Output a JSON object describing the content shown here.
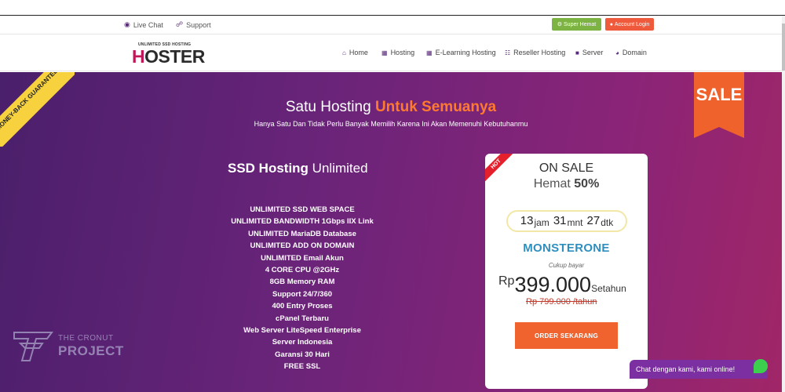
{
  "topbar": {
    "live_chat": "Live Chat",
    "support": "Support",
    "super_hemat": "Super Hemat",
    "account_login": "Account Login"
  },
  "logo": {
    "tagline": "UNLIMITED SSD HOSTING",
    "h": "H",
    "rest": "OSTER"
  },
  "nav": {
    "items": [
      {
        "label": "Home",
        "icon": "home-icon"
      },
      {
        "label": "Hosting",
        "icon": "grid-icon"
      },
      {
        "label": "E-Learning Hosting",
        "icon": "grid-icon"
      },
      {
        "label": "Reseller Hosting",
        "icon": "sitemap-icon"
      },
      {
        "label": "Server",
        "icon": "server-icon"
      },
      {
        "label": "Domain",
        "icon": "globe-icon"
      }
    ]
  },
  "hero": {
    "ribbon": "MONEY-BACK GUARANTEE",
    "sale": "SALE",
    "title_plain": "Satu Hosting ",
    "title_accent": "Untuk Semuanya",
    "subtitle": "Hanya Satu Dan Tidak Perlu Banyak Memilih Karena Ini Akan Memenuhi Kebutuhanmu",
    "plan_title_bold": "SSD Hosting",
    "plan_title_rest": " Unlimited",
    "features": [
      "UNLIMITED SSD WEB SPACE",
      "UNLIMITED BANDWIDTH 1Gbps IIX Link",
      "UNLIMITED MariaDB Database",
      "UNLIMITED ADD ON DOMAIN",
      "UNLIMITED Email Akun",
      "4 CORE CPU @2GHz",
      "8GB Memory RAM",
      "Support 24/7/360",
      "400 Entry Proses",
      "cPanel Terbaru",
      "Web Server LiteSpeed Enterprise",
      "Server Indonesia",
      "Garansi 30 Hari",
      "FREE SSL"
    ]
  },
  "card": {
    "hot": "HOT",
    "on_sale": "ON SALE",
    "hemat_label": "Hemat ",
    "hemat_value": "50%",
    "timer": {
      "hours": "13",
      "hours_unit": "jam",
      "minutes": "31",
      "minutes_unit": "mnt",
      "seconds": "27",
      "seconds_unit": "dtk"
    },
    "plan_name": "MONSTERONE",
    "pay_label": "Cukup bayar",
    "currency": "Rp",
    "amount": "399.000",
    "period": "Setahun",
    "old_price": "Rp 799.000 /tahun",
    "order_button": "ORDER SEKARANG"
  },
  "watermark": {
    "line1": "THE CRONUT",
    "line2": "PROJECT"
  },
  "chat": {
    "text": "Chat dengan kami, kami online!"
  },
  "colors": {
    "brand_purple": "#5a2a7a",
    "accent_orange": "#f0632f",
    "plan_blue": "#2e8fbf",
    "green": "#7cb342"
  }
}
